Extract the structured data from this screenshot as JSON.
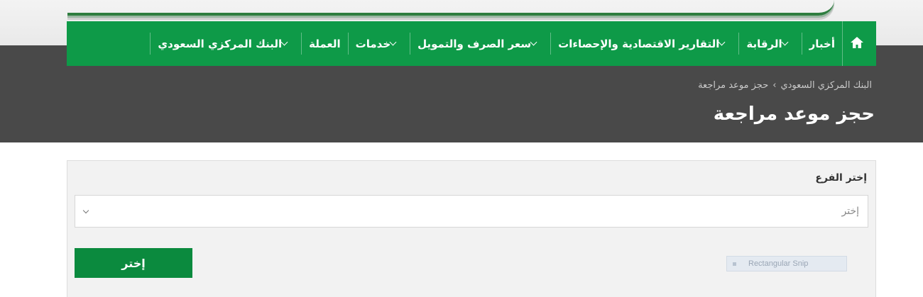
{
  "nav": {
    "home_icon": "home-icon",
    "items": [
      {
        "label": "أخبار",
        "has_dropdown": false
      },
      {
        "label": "الرقابة",
        "has_dropdown": true
      },
      {
        "label": "التقارير الاقتصادية والإحصاءات",
        "has_dropdown": true
      },
      {
        "label": "سعر الصرف والتمويل",
        "has_dropdown": true
      },
      {
        "label": "خدمات",
        "has_dropdown": true
      },
      {
        "label": "العملة",
        "has_dropdown": false
      },
      {
        "label": "البنك المركزي السعودي",
        "has_dropdown": true
      }
    ]
  },
  "breadcrumb": {
    "root": "البنك المركزي السعودي",
    "current": "حجز موعد مراجعة"
  },
  "page_title": "حجز موعد مراجعة",
  "form": {
    "branch_label": "إختر الفرع",
    "branch_select_value": "إختر",
    "submit_label": "إختر"
  },
  "overlay": {
    "snip_label": "Rectangular Snip"
  },
  "colors": {
    "nav_green": "#0e9a48",
    "button_green": "#0b8a3e",
    "header_dark": "#494949"
  }
}
